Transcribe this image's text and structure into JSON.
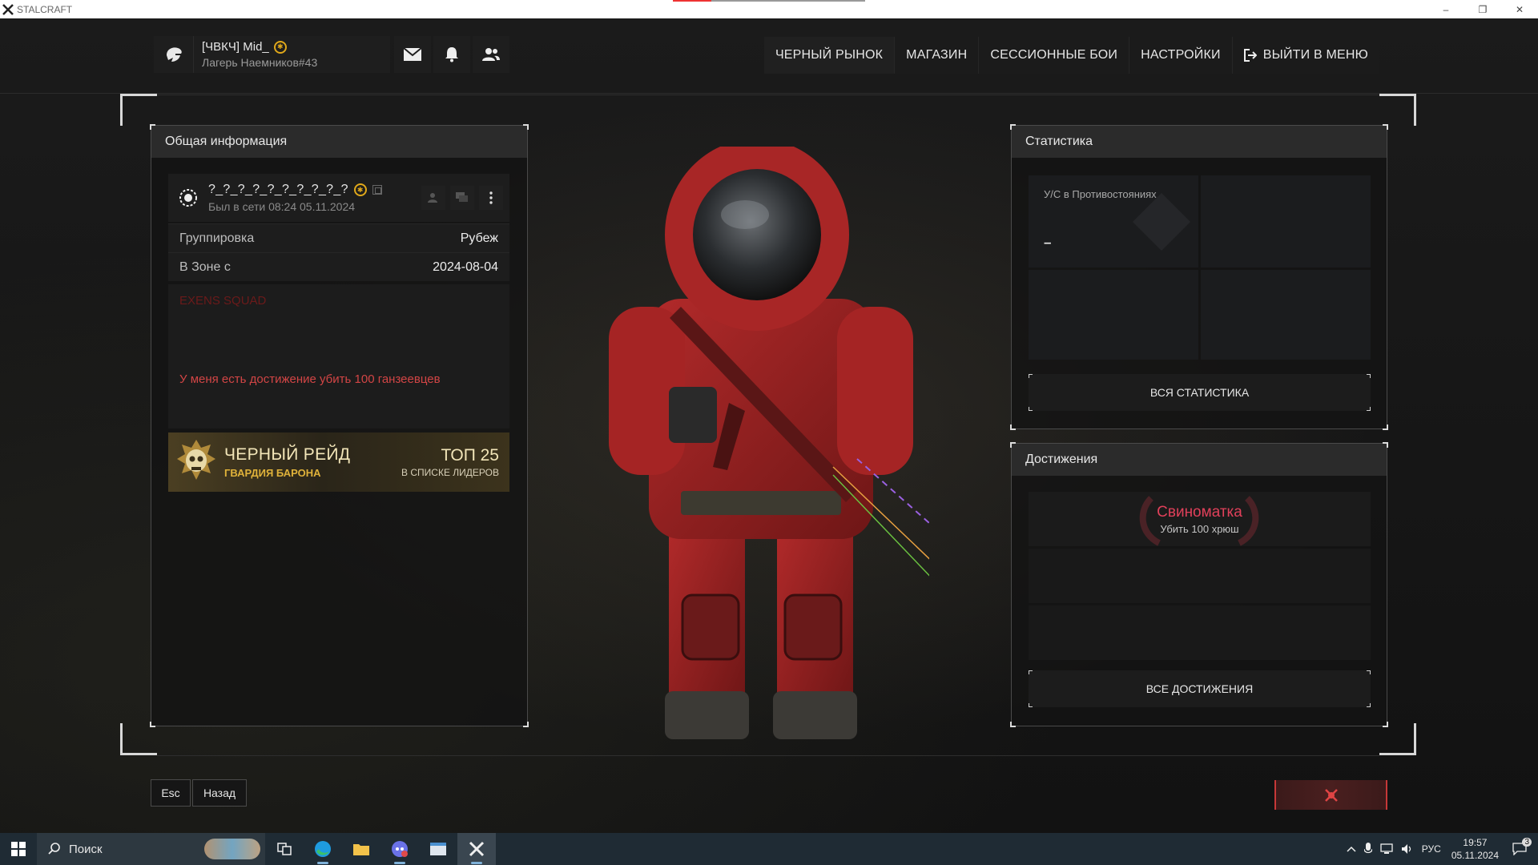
{
  "window": {
    "title": "STALCRAFT",
    "load_progress": 0.2,
    "controls": [
      "–",
      "❐",
      "✕"
    ]
  },
  "profile": {
    "name": "[ЧВКЧ] Mid_",
    "server": "Лагерь Наемников#43"
  },
  "nav": {
    "items": [
      "ЧЕРНЫЙ РЫНОК",
      "МАГАЗИН",
      "СЕССИОННЫЕ БОИ",
      "НАСТРОЙКИ",
      "ВЫЙТИ В МЕНЮ"
    ]
  },
  "general_info": {
    "header": "Общая информация",
    "player_name": "?_?_?_?_?_?_?_?_?_?",
    "last_seen": "Был в сети 08:24 05.11.2024",
    "rows": [
      {
        "label": "Группировка",
        "value": "Рубеж"
      },
      {
        "label": "В Зоне с",
        "value": "2024-08-04"
      }
    ],
    "bio_clan": "EXENS SQUAD",
    "bio_text": "У меня есть достижение убить 100 ганзеевцев",
    "raid": {
      "title": "ЧЕРНЫЙ РЕЙД",
      "subtitle": "ГВАРДИЯ БАРОНА",
      "rank": "ТОП 25",
      "rank_sub": "В СПИСКЕ ЛИДЕРОВ"
    }
  },
  "stats": {
    "header": "Статистика",
    "kd_label": "У/С в Противостояниях",
    "kd_value": "–",
    "all_button": "ВСЯ СТАТИСТИКА"
  },
  "achievements": {
    "header": "Достижения",
    "item_title": "Свиноматка",
    "item_sub": "Убить 100 хрюш",
    "all_button": "ВСЕ ДОСТИЖЕНИЯ"
  },
  "bottom": {
    "esc_label": "Esc",
    "back_label": "Назад"
  },
  "taskbar": {
    "search_placeholder": "Поиск",
    "lang": "РУС",
    "time": "19:57",
    "date": "05.11.2024",
    "notifications": "3"
  },
  "colors": {
    "accent_red": "#d24545",
    "gold": "#e0a81a",
    "achievement_red": "#e0405a"
  }
}
